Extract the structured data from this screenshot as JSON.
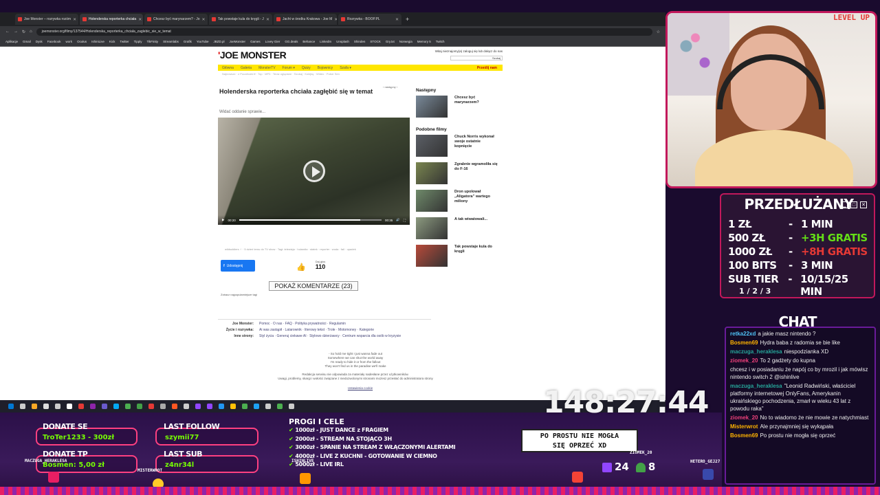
{
  "browser": {
    "tabs": [
      {
        "label": "Joe Monster – rozrywka rozśm",
        "active": false
      },
      {
        "label": "Holenderska reporterka chciała",
        "active": true
      },
      {
        "label": "Chcesz być marynarzem? - Jo",
        "active": false
      },
      {
        "label": "Tak powstaje kula do kręgli - J",
        "active": false
      },
      {
        "label": "Jacht w środku Krakowa - Joe M",
        "active": false
      },
      {
        "label": "Rozrywka - BOOP.PL",
        "active": false
      }
    ],
    "url": "joemonster.org/filmy/137544/Holenderska_reporterka_chciala_zaglebic_sie_w_temat",
    "bookmarks": [
      "Aplikacje",
      "Gmail",
      "Dysk",
      "Facebook",
      "work",
      "Ocułus",
      "IshiniLive",
      "Kick",
      "Twitter",
      "Tipply",
      "TikFinity",
      "Streamlabs",
      "Grafik",
      "YouTube",
      "JBZD.pl",
      "JoeMonster",
      "Games",
      "Lovey Gier",
      "GG.deals",
      "Behance",
      "LinkedIn",
      "Unsplash",
      "Shinden",
      "STOCK",
      "Gry.txt",
      "Norwegia",
      "Memory 5",
      "Twitch"
    ]
  },
  "site": {
    "logo_mark": "'",
    "logo_text": "JOE MONSTER",
    "welcome": "Witaj nieznajomy(a) zaloguj się lub dołącz do nas",
    "search_btn": "Szukaj",
    "nav": [
      "Główna",
      "Galeria",
      "MonsterTV",
      "Forum ▾",
      "Quizy",
      "Bojownicy",
      "Szafa ▾"
    ],
    "send": "Prześlij nam",
    "subnav": "Najnowsze · z Poczekalni ▾ · Top · MP3 · Teraz oglądane · Szukaj · Kolejkę · Wideo · Pobór Sen",
    "prev_next": "‹   następny ›",
    "title": "Holenderska reporterka chciała zagłębić się w temat",
    "subtitle": "Widać oddanie sprawie...",
    "video_time_left": "00:20",
    "video_time_right": "00:35",
    "meta": "wildsoldiers ♂ · 5 dzień temu do TV show · Tagi: telewizja · holandia · statek · reporter · woda · fail · upadek",
    "fb_label": "Udostępnij",
    "votes_label": "Daj głos",
    "votes": "110",
    "comments_btn": "POKAŻ KOMENTARZE (23)",
    "tags_link": "Zobacz najpopularniejsze tagi",
    "footer": [
      {
        "label": "Joe Monster:",
        "value": "Pomoc · O nas · FAQ · Polityka prywatności · Regulamin"
      },
      {
        "label": "Życie i rozrywka:",
        "value": "Ai was zastąpił · Latarownik · literowy tekst · Trole · Motomoney · Kategorie"
      },
      {
        "label": "Inne strony:",
        "value": "Styl życia · Generuj ciekawe AI · Stylowo dzierżawcy · Centrum wsparcia dla osób w kryzysie"
      }
    ],
    "poem": [
      "- So hold me tight I just wanna fade out",
      "Somewhere we can shut the world away",
      "I'm ready to hide it or from the fallout",
      "They won't find us in the paradise we'll make"
    ],
    "disclaimer": [
      "Redakcja serwisu nie odpowiada za materiały nadesłane przez użytkowników.",
      "Uwagi, problemy, skargi i wołości związane z niedozwolonymi stronami możesz przesłać do administratora strony"
    ],
    "cookie": "Ustawienia cookie",
    "sidebar_next": "Następny",
    "sidebar_similar": "Podobne filmy",
    "next_items": [
      {
        "title": "Chcesz być marynarzem?"
      }
    ],
    "similar_items": [
      {
        "title": "Chuck Norris wykonał swoje ostatnie kopnięcie"
      },
      {
        "title": "Zgrabnie wgramoliła się do F-16"
      },
      {
        "title": "Dron upolował „Aligatora” wartego miliony"
      },
      {
        "title": "A tak wiwatowali..."
      },
      {
        "title": "Tak powstaje kula do kręgli"
      }
    ]
  },
  "overlay": {
    "level_badge": "LEVEL UP",
    "price_title": "PRZEDŁUŻANY",
    "price_rows": [
      {
        "amount": "1 ZŁ",
        "dash": "-",
        "value": "1 MIN",
        "extra": ""
      },
      {
        "amount": "500 ZŁ",
        "dash": "-",
        "value": "+3H GRATIS",
        "extra": "g"
      },
      {
        "amount": "1000 ZŁ",
        "dash": "-",
        "value": "+8H GRATIS",
        "extra": "r"
      },
      {
        "amount": "100 BITS",
        "dash": "-",
        "value": "3 MIN",
        "extra": ""
      },
      {
        "amount": "SUB TIER",
        "dash": "-",
        "value": "10/15/25 MIN",
        "extra": ""
      }
    ],
    "sub_tier_sub": "1 / 2 / 3",
    "chat_title": "CHAT",
    "chat": [
      {
        "user": "retka22xd",
        "text": "a jakie masz nintendo ?",
        "color": "#4fc3f7"
      },
      {
        "user": "Bosmen69",
        "text": "Hydra baba z radomia se bie like",
        "color": "#ffb300"
      },
      {
        "user": "maczuga_heraklesa",
        "text": "niespodzianka XD",
        "color": "#26a69a"
      },
      {
        "user": "ziomek_20",
        "text": "To 2 gadżety do kupna",
        "color": "#ec407a"
      },
      {
        "user": "",
        "text": "chcesz i w posiadaniu że napój co by mrozil i jak mówisz nintendo switch 2 @ishinlive",
        "color": "#fff"
      },
      {
        "user": "maczuga_heraklesa",
        "text": "\"Leonid Radwiński, właściciel platformy internetowej OnlyFans, Amerykanin ukraińskiego pochodzenia, zmarł w wieku 43 lat z powodu raka\"",
        "color": "#26a69a"
      },
      {
        "user": "ziomek_20",
        "text": "No to wiadomo że nie mowie ze natychmiast",
        "color": "#ec407a"
      },
      {
        "user": "Misterwrot",
        "text": "Ale przynajmniej się wykąpała",
        "color": "#ffb300"
      },
      {
        "user": "Bosmen69",
        "text": "Po prostu nie mogła się oprzeć",
        "color": "#ffb300"
      }
    ],
    "donate_label": "DONATE SE",
    "donate_value": "TroTer1233 - 300zł",
    "donate_tp_label": "DONATE TP",
    "donate_tp_value": "Bosmen: 5,00 zł",
    "last_follow_label": "LAST FOLLOW",
    "last_follow_value": "szymii77",
    "last_sub_label": "LAST SUB",
    "last_sub_value": "z4nr34l",
    "goals_title": "PROGI I CELE",
    "goals": [
      "1000zł - JUST DANCE z FRAGIEM",
      "2000zł - STREAM NA STOJĄCO 3H",
      "3000zł - SPANIE NA STREAM Z WŁĄCZONYMI ALERTAMI",
      "4000zł - LIVE Z KUCHNI - GOTOWANIE W CIEMNO",
      "5000zł - LIVE IRL"
    ],
    "timer": "148:27:44",
    "bubble": "PO PROSTU NIE MOGŁA\nSIĘ OPRZEĆ XD",
    "viewers": "24",
    "followers": "8",
    "sprite_names": [
      "MACZUGA_HERAKLESA",
      "MISTERWROT",
      "ISHINLIVE",
      "ZIOMEK_20",
      "HETERO_GEJ27"
    ]
  }
}
